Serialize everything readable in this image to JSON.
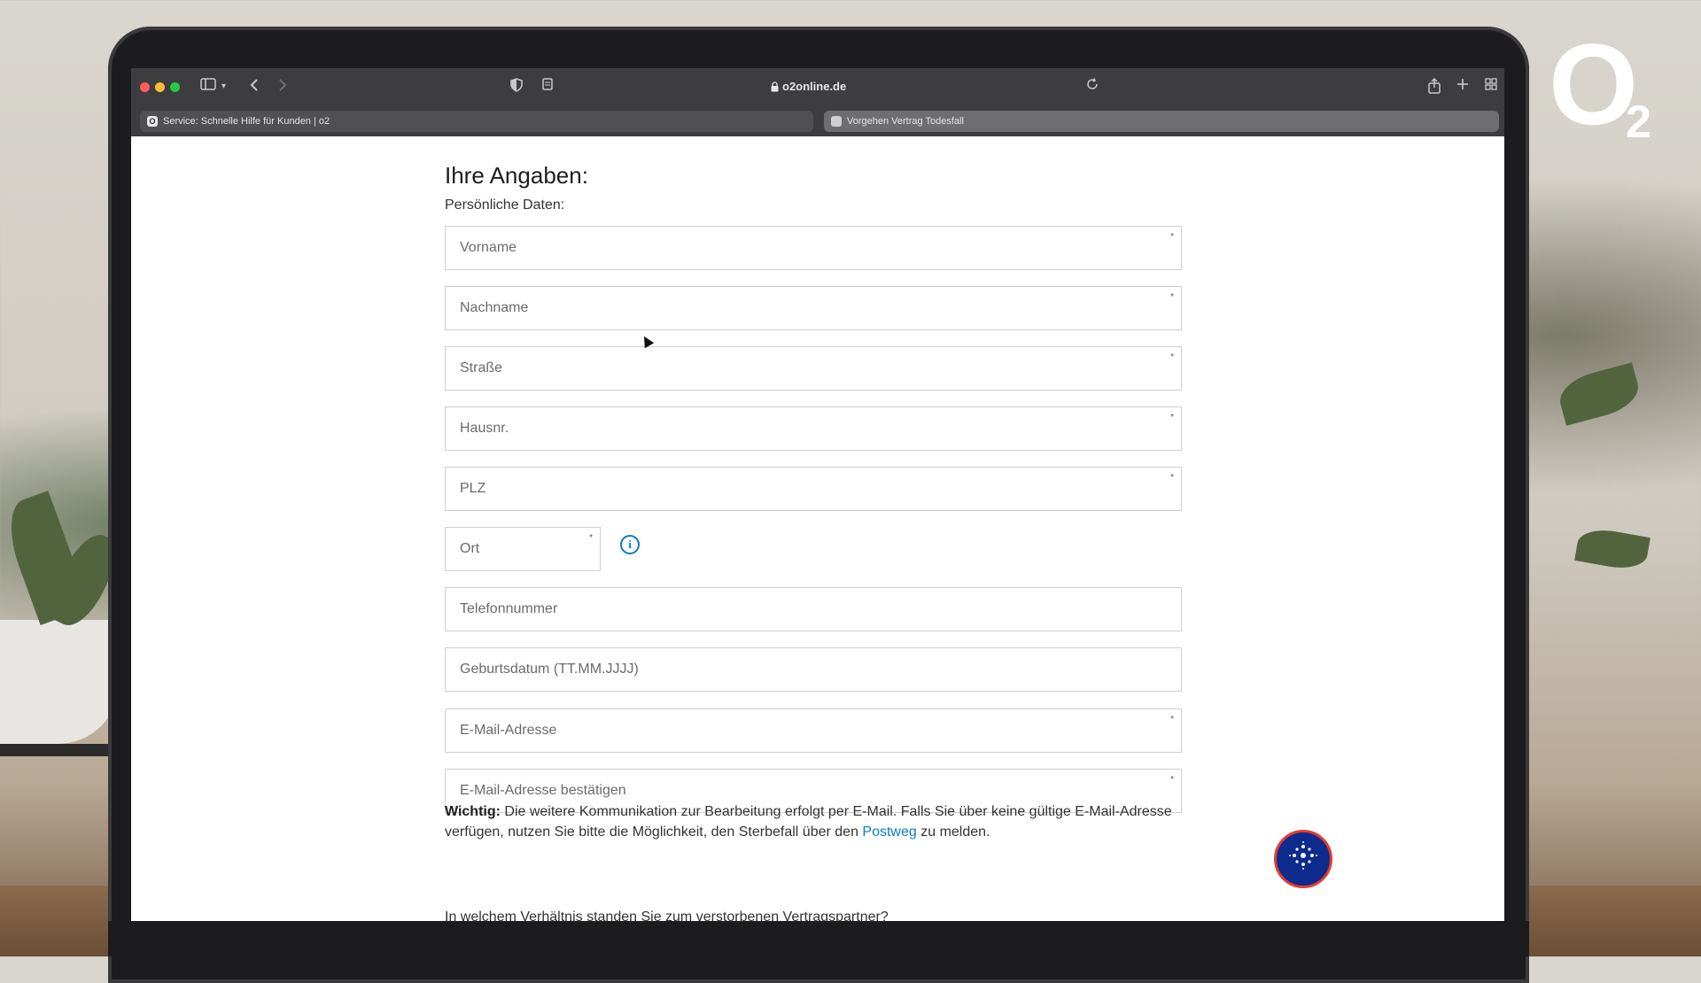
{
  "browser": {
    "url": "o2online.de",
    "tabs": [
      {
        "label": "Service: Schnelle Hilfe für Kunden | o2",
        "favicon": "O"
      },
      {
        "label": "Vorgehen Vertrag Todesfall"
      }
    ]
  },
  "form": {
    "title": "Ihre Angaben:",
    "subtitle": "Persönliche Daten:",
    "fields": [
      {
        "placeholder": "Vorname",
        "required": true
      },
      {
        "placeholder": "Nachname",
        "required": true
      },
      {
        "placeholder": "Straße",
        "required": true
      },
      {
        "placeholder": "Hausnr.",
        "required": true
      },
      {
        "placeholder": "PLZ",
        "required": true
      },
      {
        "placeholder": "Ort",
        "required": true
      },
      {
        "placeholder": "Telefonnummer",
        "required": false
      },
      {
        "placeholder": "Geburtsdatum (TT.MM.JJJJ)",
        "required": false
      },
      {
        "placeholder": "E-Mail-Adresse",
        "required": true
      },
      {
        "placeholder": "E-Mail-Adresse bestätigen",
        "required": true
      }
    ],
    "required_marker": "*",
    "info_icon": "i",
    "note": {
      "label": "Wichtig:",
      "text_before": " Die weitere Kommunikation zur Bearbeitung erfolgt per E-Mail. Falls Sie über keine gültige E-Mail-Adresse verfügen, nutzen Sie bitte die Möglichkeit, den Sterbefall über den ",
      "link": "Postweg",
      "text_after": " zu melden."
    },
    "next_question": "In welchem Verhältnis standen Sie zum verstorbenen Vertragspartner?"
  },
  "brand": {
    "logo_letter": "O",
    "logo_sub": "2",
    "accent_color": "#0c7cc2",
    "assistant_color": "#0d2b8c"
  },
  "icons": {
    "sidebar": "sidebar-icon",
    "back": "chevron-left-icon",
    "forward": "chevron-right-icon",
    "shield": "shield-icon",
    "reader": "reader-icon",
    "lock": "lock-icon",
    "reload": "reload-icon",
    "share": "share-icon",
    "new_tab": "plus-icon",
    "tab_overview": "grid-icon",
    "assistant": "sparkle-icon"
  }
}
